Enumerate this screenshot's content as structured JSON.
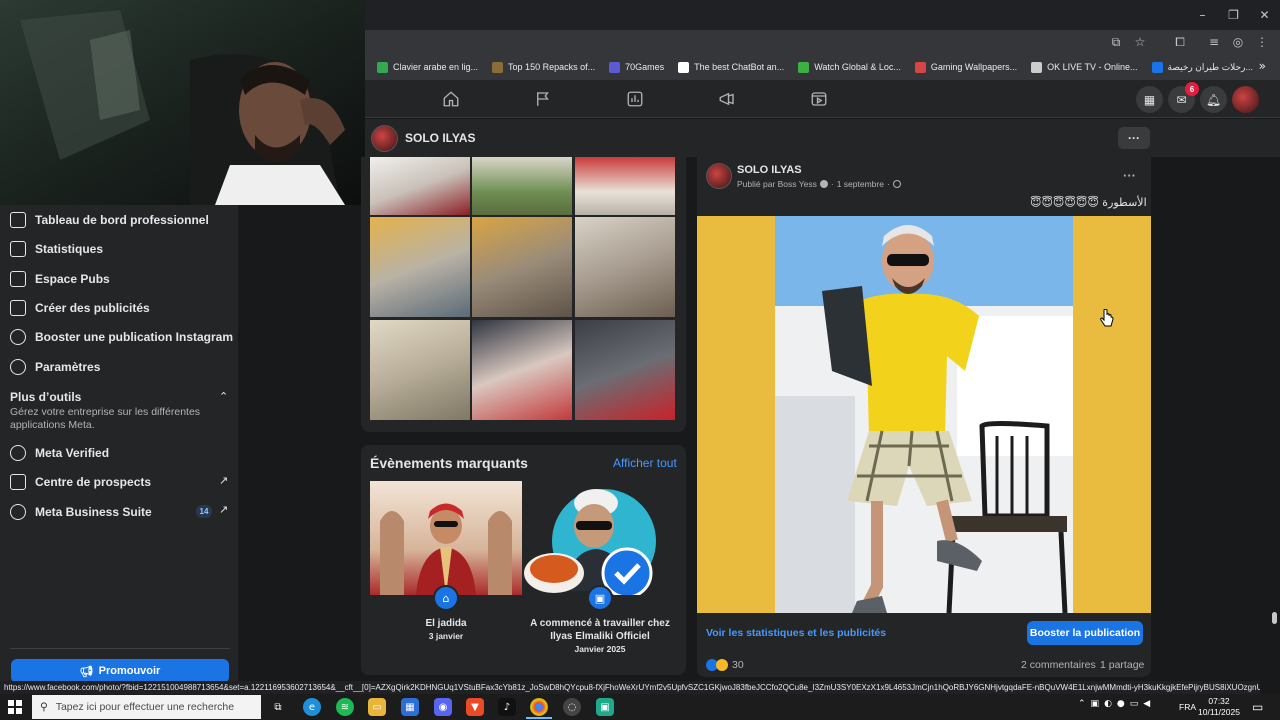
{
  "window": {
    "controls": [
      "–",
      "❐",
      "✕"
    ]
  },
  "bookmarks": [
    {
      "label": "Clavier arabe en lig...",
      "color": "#34a853"
    },
    {
      "label": "Top 150 Repacks of...",
      "color": "#8a6d3b"
    },
    {
      "label": "70Games",
      "color": "#5b5bd6"
    },
    {
      "label": "The best ChatBot an...",
      "color": "#ffffff"
    },
    {
      "label": "Watch Global & Loc...",
      "color": "#3cb043"
    },
    {
      "label": "Gaming Wallpapers...",
      "color": "#d64545"
    },
    {
      "label": "OK LIVE TV - Online...",
      "color": "#cccccc"
    },
    {
      "label": "رحلات طيران رخيصة...",
      "color": "#1a73e8"
    }
  ],
  "nav": {
    "messenger_badge": "6"
  },
  "page": {
    "name": "SOLO ILYAS",
    "more": "···"
  },
  "sidebar": {
    "items": [
      {
        "label": "Tableau de bord professionnel"
      },
      {
        "label": "Statistiques"
      },
      {
        "label": "Espace Pubs"
      },
      {
        "label": "Créer des publicités"
      },
      {
        "label": "Booster une publication Instagram"
      },
      {
        "label": "Paramètres"
      }
    ],
    "tools_title": "Plus d’outils",
    "tools_desc": "Gérez votre entreprise sur les différentes applications Meta.",
    "tools_items": [
      {
        "label": "Meta Verified"
      },
      {
        "label": "Centre de prospects"
      },
      {
        "label": "Meta Business Suite",
        "badge": "14"
      }
    ],
    "promote_label": "Promouvoir"
  },
  "events": {
    "title": "Évènements marquants",
    "link": "Afficher tout",
    "items": [
      {
        "title": "El jadida",
        "date": "3 janvier"
      },
      {
        "title": "A commencé à travailler chez Ilyas Elmaliki Officiel",
        "date": "Janvier 2025"
      }
    ]
  },
  "post": {
    "author": "SOLO ILYAS",
    "published_by": "Publié par Boss Yess",
    "date": "1 septembre",
    "text": "الأسطورة 😇😇😇😇😇😇",
    "stats_link": "Voir les statistiques et les publicités",
    "boost_label": "Booster la publication",
    "reaction_count": "30",
    "comments": "2 commentaires",
    "shares": "1 partage"
  },
  "status_url": "https://www.facebook.com/photo/?fbid=122151004988713654&set=a.122116953602713654&__cft__[0]=AZXgQirk2KDHNGUq1VStuBFax3cYb81z_JoSwD8hQYcpu8-fXjFhoWeXrUYmf2v5UpfvSZC1GKjwoJ83fbeJCCfo2QCu8e_I3ZmU3SY0EXzX1x9L4653JmCjn1hQoRBJY6GNHjvtgqdaFE-nBQuVW4E1LxnjwMMmdti-yH3kuKkgjkEfePijryBUS8iXUOzgnU5CJ2go-...",
  "taskbar": {
    "search_placeholder": "Tapez ici pour effectuer une recherche",
    "lang": "FRA",
    "time": "07:32",
    "date": "10/11/2025"
  }
}
